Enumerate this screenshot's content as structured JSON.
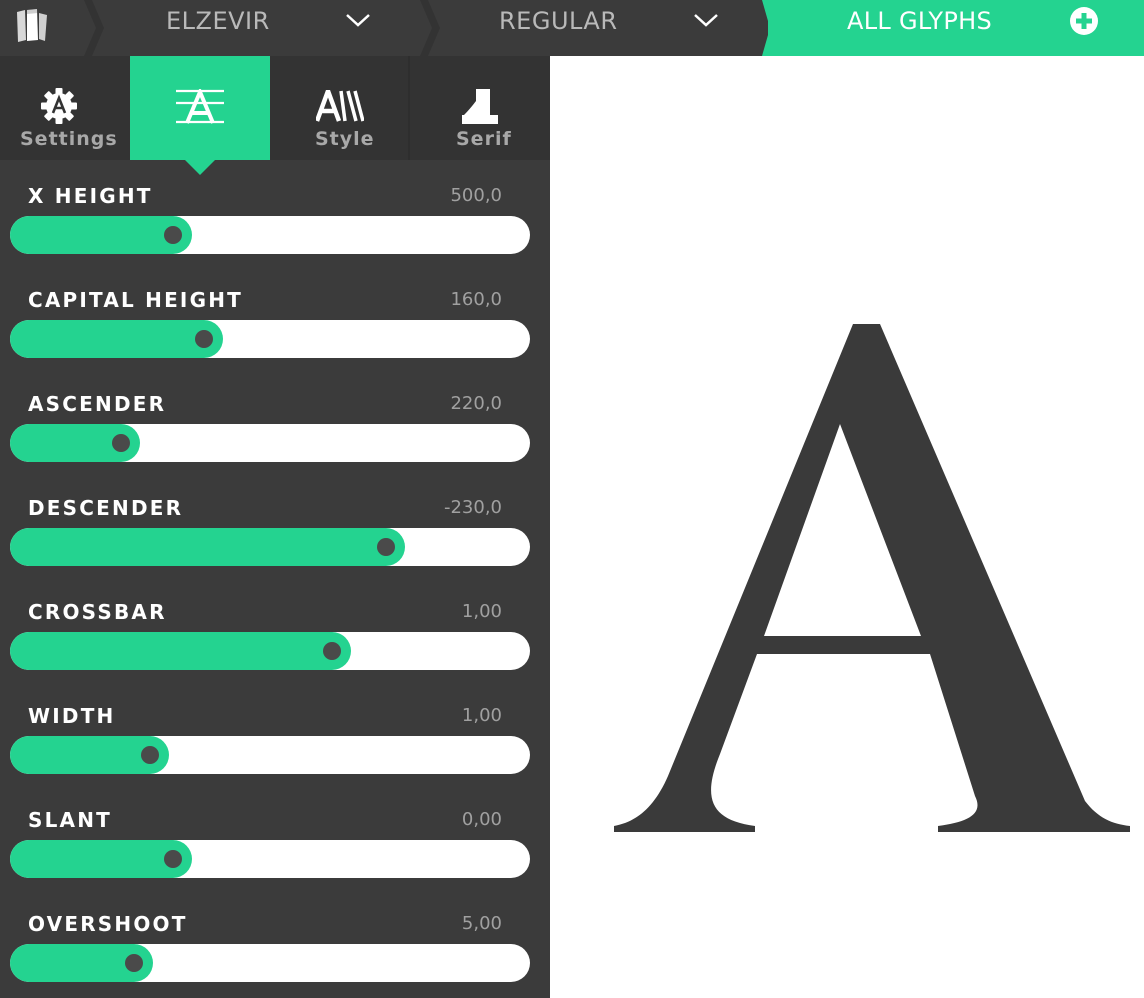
{
  "topbar": {
    "family": "ELZEVIR",
    "style": "REGULAR",
    "glyphs_tab": "ALL GLYPHS"
  },
  "tabs": [
    {
      "label": "Settings",
      "icon": "settings-icon",
      "active": false
    },
    {
      "label": "",
      "icon": "font-metrics-icon",
      "active": true
    },
    {
      "label": "Style",
      "icon": "style-icon",
      "active": false
    },
    {
      "label": "Serif",
      "icon": "serif-icon",
      "active": false
    }
  ],
  "sliders": [
    {
      "label": "X HEIGHT",
      "value": "500,0",
      "fraction": 0.35
    },
    {
      "label": "CAPITAL HEIGHT",
      "value": "160,0",
      "fraction": 0.41
    },
    {
      "label": "ASCENDER",
      "value": "220,0",
      "fraction": 0.25
    },
    {
      "label": "DESCENDER",
      "value": "-230,0",
      "fraction": 0.76
    },
    {
      "label": "CROSSBAR",
      "value": "1,00",
      "fraction": 0.655
    },
    {
      "label": "WIDTH",
      "value": "1,00",
      "fraction": 0.305
    },
    {
      "label": "SLANT",
      "value": "0,00",
      "fraction": 0.35
    },
    {
      "label": "OVERSHOOT",
      "value": "5,00",
      "fraction": 0.275
    }
  ],
  "preview": {
    "glyph": "A"
  },
  "colors": {
    "accent": "#24d390",
    "panel": "#3b3b3b",
    "tabbar": "#333333",
    "glyph": "#3a3a3a"
  }
}
